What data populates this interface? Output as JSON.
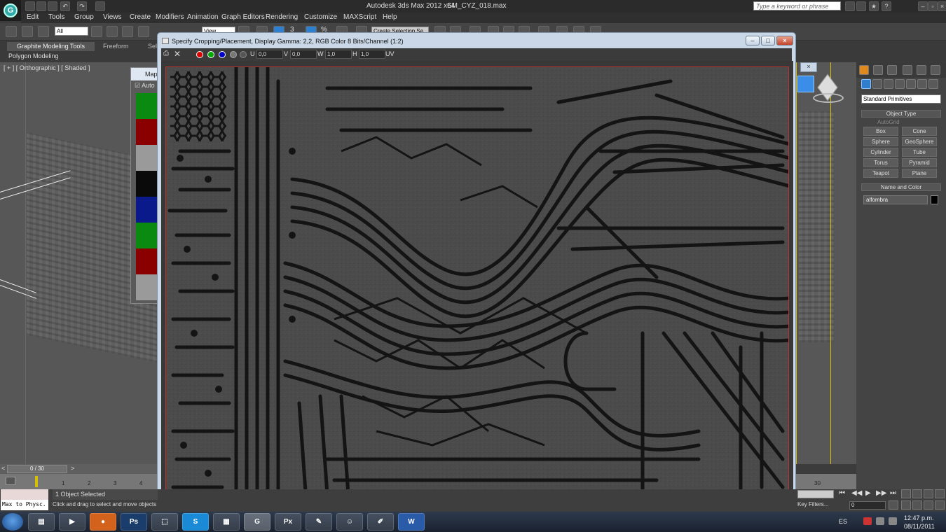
{
  "app": {
    "title": "Autodesk 3ds Max  2012 x64",
    "filename": "EM_CYZ_018.max",
    "search_placeholder": "Type a keyword or phrase"
  },
  "menu": [
    "Edit",
    "Tools",
    "Group",
    "Views",
    "Create",
    "Modifiers",
    "Animation",
    "Graph Editors",
    "Rendering",
    "Customize",
    "MAXScript",
    "Help"
  ],
  "toolbar": {
    "filter_value": "All",
    "view_value": "View",
    "selection_set": "Create Selection Se",
    "snap_value": "3",
    "percent": "%"
  },
  "ribbon": {
    "tabs": [
      "Graphite Modeling Tools",
      "Freeform",
      "Sel"
    ],
    "subtitle": "Polygon Modeling"
  },
  "viewport": {
    "label": "[ + ] [ Orthographic ] [ Shaded ]"
  },
  "map_dialog": {
    "title": "Map",
    "auto": "Auto",
    "swatches": [
      "#0a8a10",
      "#8a0000",
      "#9a9a9a",
      "#0a0a0a",
      "#0a1a8a",
      "#0a8a10",
      "#8a0000",
      "#9a9a9a"
    ]
  },
  "crop_dialog": {
    "title": "Specify Cropping/Placement, Display Gamma: 2,2, RGB Color 8 Bits/Channel (1:2)",
    "u_label": "U",
    "u_value": "0,0",
    "v_label": "V",
    "v_value": "0,0",
    "w_label": "W",
    "w_value": "1,0",
    "h_label": "H",
    "h_value": "1,0",
    "uv_label": "UV"
  },
  "command_panel": {
    "primitive_type": "Standard Primitives",
    "object_type_header": "Object Type",
    "autogrid": "AutoGrid",
    "buttons": [
      "Box",
      "Cone",
      "Sphere",
      "GeoSphere",
      "Cylinder",
      "Tube",
      "Torus",
      "Pyramid",
      "Teapot",
      "Plane"
    ],
    "name_color_header": "Name and Color",
    "object_name": "alfombra"
  },
  "timeline": {
    "frame_display": "0 / 30",
    "ticks": [
      "1",
      "2",
      "3",
      "4"
    ],
    "end_tick": "30"
  },
  "status": {
    "listener": "Max to Physc.",
    "selected": "1 Object Selected",
    "prompt": "Click and drag to select and move objects",
    "key_filters": "Key Filters...",
    "frame_input": "0"
  },
  "taskbar": {
    "language": "ES",
    "time": "12:47 p.m.",
    "date": "08/11/2011"
  }
}
